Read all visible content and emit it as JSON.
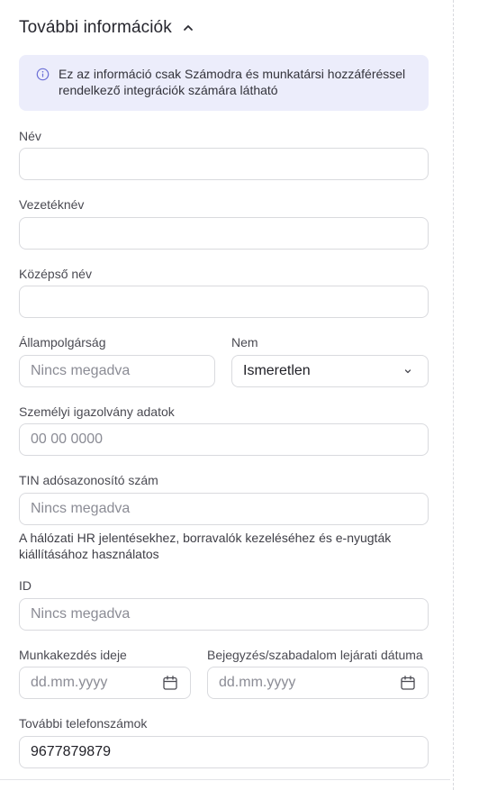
{
  "section": {
    "title": "További információk"
  },
  "info": {
    "text": "Ez az információ csak Számodra és munkatársi hozzáféréssel rendelkező integrációk számára látható"
  },
  "fields": {
    "nev": {
      "label": "Név",
      "value": ""
    },
    "vezeteknev": {
      "label": "Vezetéknév",
      "value": ""
    },
    "kozepso_nev": {
      "label": "Középső név",
      "value": ""
    },
    "allampolgarsag": {
      "label": "Állampolgárság",
      "placeholder": "Nincs megadva"
    },
    "nem": {
      "label": "Nem",
      "value": "Ismeretlen"
    },
    "szemelyi": {
      "label": "Személyi igazolvány adatok",
      "placeholder": "00 00 0000"
    },
    "tin": {
      "label": "TIN adósazonosító szám",
      "placeholder": "Nincs megadva",
      "helper": "A hálózati HR jelentésekhez, borravalók kezeléséhez és e-nyugták kiállításához használatos"
    },
    "id": {
      "label": "ID",
      "placeholder": "Nincs megadva"
    },
    "munkakezdes": {
      "label": "Munkakezdés ideje",
      "placeholder": "dd.mm.yyyy"
    },
    "bejegyzes": {
      "label": "Bejegyzés/szabadalom lejárati dátuma",
      "placeholder": "dd.mm.yyyy"
    },
    "telefon": {
      "label": "További telefonszámok",
      "value": "9677879879"
    }
  },
  "icons": {
    "collapse": "chevron-up-icon",
    "info": "info-circle-icon",
    "select": "chevron-down-icon",
    "calendar": "calendar-icon"
  },
  "colors": {
    "info_bg": "#ecedfb",
    "info_icon": "#6b6fd6",
    "border": "#d9dade"
  }
}
